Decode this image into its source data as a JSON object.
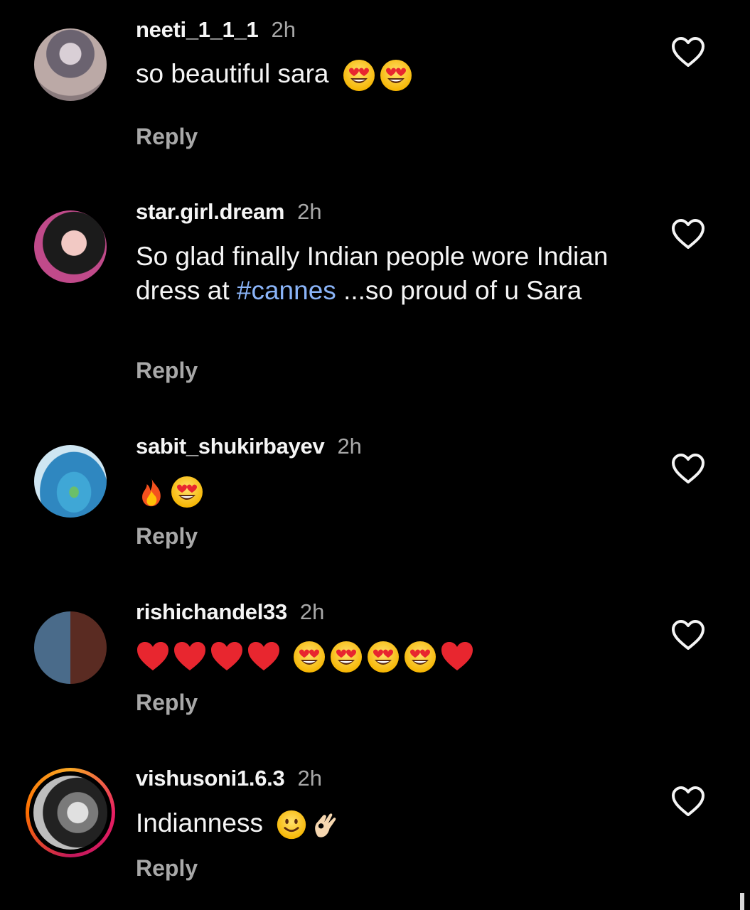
{
  "comments": [
    {
      "username": "neeti_1_1_1",
      "time": "2h",
      "text": "so beautiful sara",
      "emojis": [
        "heart-eyes",
        "heart-eyes"
      ],
      "reply": "Reply"
    },
    {
      "username": "star.girl.dream",
      "time": "2h",
      "text_before": "So glad finally Indian people wore Indian dress at ",
      "hashtag": "#cannes",
      "text_after": " ...so proud of u Sara",
      "reply": "Reply"
    },
    {
      "username": "sabit_shukirbayev",
      "time": "2h",
      "emojis": [
        "fire",
        "heart-eyes"
      ],
      "reply": "Reply"
    },
    {
      "username": "rishichandel33",
      "time": "2h",
      "emojis": [
        "red-heart",
        "red-heart",
        "red-heart",
        "red-heart",
        "heart-eyes",
        "heart-eyes",
        "heart-eyes",
        "heart-eyes",
        "red-heart"
      ],
      "reply": "Reply"
    },
    {
      "username": "vishusoni1.6.3",
      "time": "2h",
      "text": "Indianness",
      "emojis": [
        "slight-smile",
        "ok-hand"
      ],
      "reply": "Reply"
    }
  ],
  "colors": {
    "background": "#000000",
    "username": "#f5f5f5",
    "secondary": "#a8a8a8",
    "hashtag": "#8ab4f8"
  },
  "icons": {
    "like": "heart-outline-icon"
  }
}
